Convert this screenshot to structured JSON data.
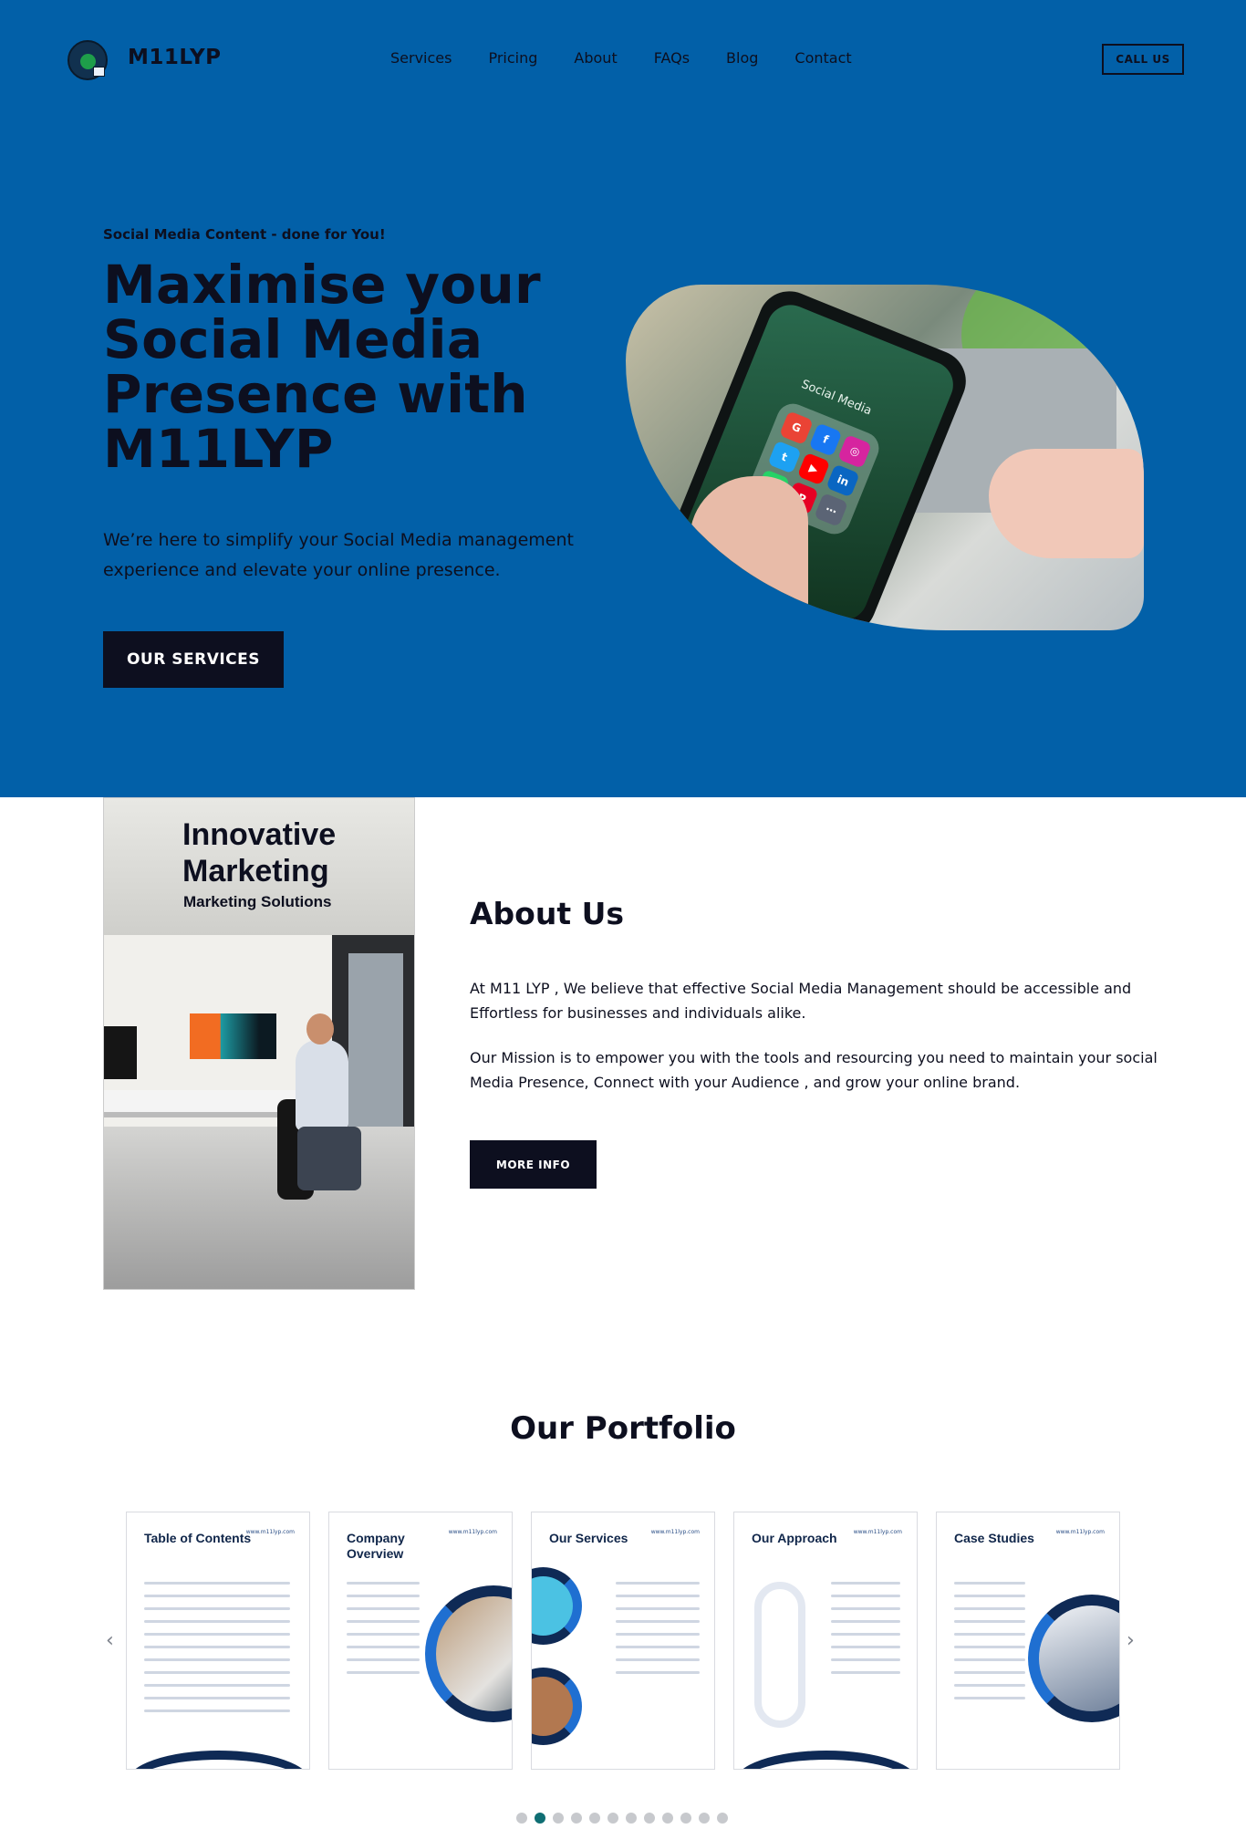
{
  "header": {
    "brand": "M11LYP",
    "nav": [
      "Services",
      "Pricing",
      "About",
      "FAQs",
      "Blog",
      "Contact"
    ],
    "call_label": "CALL US"
  },
  "hero": {
    "tagline": "Social Media Content - done for You!",
    "title": "Maximise your Social Media Presence with M11LYP",
    "text": "We’re here to simplify your Social Media management experience and elevate your online presence.",
    "button": "OUR SERVICES",
    "image": {
      "phone_title": "Social Media",
      "icons": [
        "G",
        "f",
        "◎",
        "t",
        "▶",
        "in",
        "✆",
        "P",
        "⋯"
      ],
      "icon_colors": [
        "#ea4335",
        "#1877f2",
        "#d6249f",
        "#1da1f2",
        "#ff0000",
        "#0a66c2",
        "#25d366",
        "#e60023",
        "#5b6475"
      ]
    }
  },
  "about": {
    "image_title": "Innovative Marketing",
    "image_subtitle": "Marketing Solutions",
    "heading": "About Us",
    "p1": "At M11 LYP , We believe that effective Social Media Management should be accessible and Effortless for businesses and individuals alike.",
    "p2": "Our Mission is to empower you with the tools and resourcing you need to maintain your social Media Presence, Connect with your Audience , and grow your online brand.",
    "button": "MORE INFO"
  },
  "portfolio": {
    "heading": "Our Portfolio",
    "prev_icon": "chevron-left-icon",
    "next_icon": "chevron-right-icon",
    "cards": [
      {
        "title": "Table of Contents",
        "url": "www.m11lyp.com"
      },
      {
        "title": "Company Overview",
        "url": "www.m11lyp.com"
      },
      {
        "title": "Our Services",
        "url": "www.m11lyp.com"
      },
      {
        "title": "Our Approach",
        "url": "www.m11lyp.com"
      },
      {
        "title": "Case Studies",
        "url": "www.m11lyp.com"
      }
    ],
    "dots": 12,
    "active_dot": 1
  },
  "colors": {
    "hero_background": "#0260a8",
    "dark": "#0d0f1f",
    "card_navy": "#0f2a55",
    "card_blue": "#1f6fd1",
    "active_dot": "#0f6e73"
  }
}
